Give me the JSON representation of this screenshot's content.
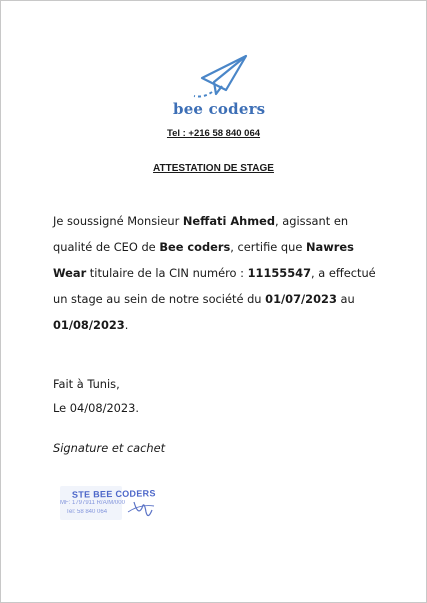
{
  "logo": {
    "brand": "bee coders",
    "color": "#3d6fb6"
  },
  "phone": "Tel : +216 58 840 064",
  "title": "ATTESTATION DE STAGE",
  "body": {
    "t1": "Je soussigné Monsieur ",
    "ceo_name": "Neffati Ahmed",
    "t2": ", agissant en qualité de CEO de ",
    "company": "Bee coders",
    "t3": ", certifie que ",
    "intern": "Nawres Wear",
    "t4": " titulaire de la CIN numéro : ",
    "cin": "11155547",
    "t5": ", a effectué un stage au sein de notre société du ",
    "start_date": "01/07/2023",
    "t6": " au ",
    "end_date": "01/08/2023",
    "t7": "."
  },
  "place_line": "Fait à Tunis,",
  "date_line": "Le 04/08/2023.",
  "signature_label": "Signature et cachet",
  "stamp": {
    "title": "STE BEE CODERS",
    "line1": "MF: 1797911 R/A/M/000",
    "line2": "Tel: 58 840 064",
    "color": "#4d67c9"
  }
}
